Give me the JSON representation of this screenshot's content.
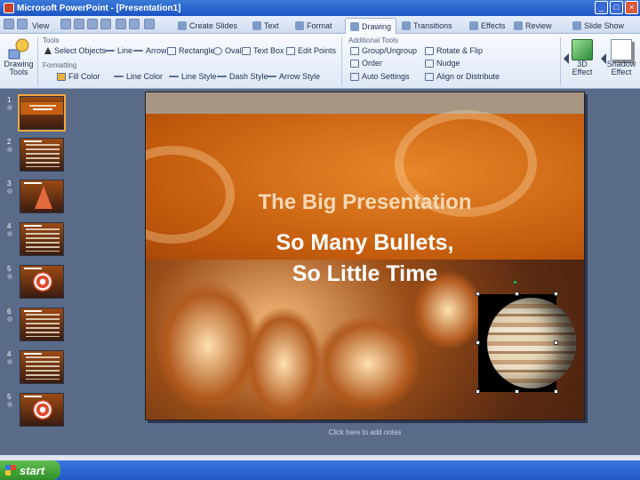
{
  "window": {
    "title": "Microsoft PowerPoint - [Presentation1]"
  },
  "tabs": [
    {
      "label": "Create Slides"
    },
    {
      "label": "Text"
    },
    {
      "label": "Format"
    },
    {
      "label": "Drawing",
      "active": true
    },
    {
      "label": "Transitions"
    },
    {
      "label": "Effects"
    },
    {
      "label": "Review"
    },
    {
      "label": "Slide Show"
    }
  ],
  "quick_access_label": "View",
  "ribbon": {
    "drawing_tools_label": "Drawing Tools",
    "group_tools": "Tools",
    "group_formatting": "Formatting",
    "group_additional": "Additional Tools",
    "tools": [
      "Select Objects",
      "Line",
      "Arrow",
      "Rectangle",
      "Oval",
      "Text Box",
      "Edit Points"
    ],
    "formatting": [
      "Fill Color",
      "Line Color",
      "Line Style",
      "Dash Style",
      "Arrow Style"
    ],
    "additional": [
      "Group/Ungroup",
      "Order",
      "Auto Settings",
      "Rotate & Flip",
      "Nudge",
      "Align or Distribute"
    ],
    "effects_3d": "3D Effect",
    "shadow": "Shadow Effect"
  },
  "thumbnails": [
    {
      "num": "1",
      "kind": "title",
      "selected": true
    },
    {
      "num": "2",
      "kind": "bullets"
    },
    {
      "num": "3",
      "kind": "pyramid"
    },
    {
      "num": "4",
      "kind": "bullets"
    },
    {
      "num": "5",
      "kind": "target"
    },
    {
      "num": "6",
      "kind": "bullets"
    },
    {
      "num": "4",
      "kind": "bullets"
    },
    {
      "num": "5",
      "kind": "target"
    }
  ],
  "slide": {
    "title": "The Big Presentation",
    "subtitle_line1": "So Many Bullets,",
    "subtitle_line2": "So Little Time"
  },
  "notes_placeholder": "Click here to add notes",
  "taskbar": {
    "start_label": "start"
  },
  "colors": {
    "accent": "#c25b0c",
    "title_text": "#f5d9b5",
    "selection": "#f2a93a"
  }
}
